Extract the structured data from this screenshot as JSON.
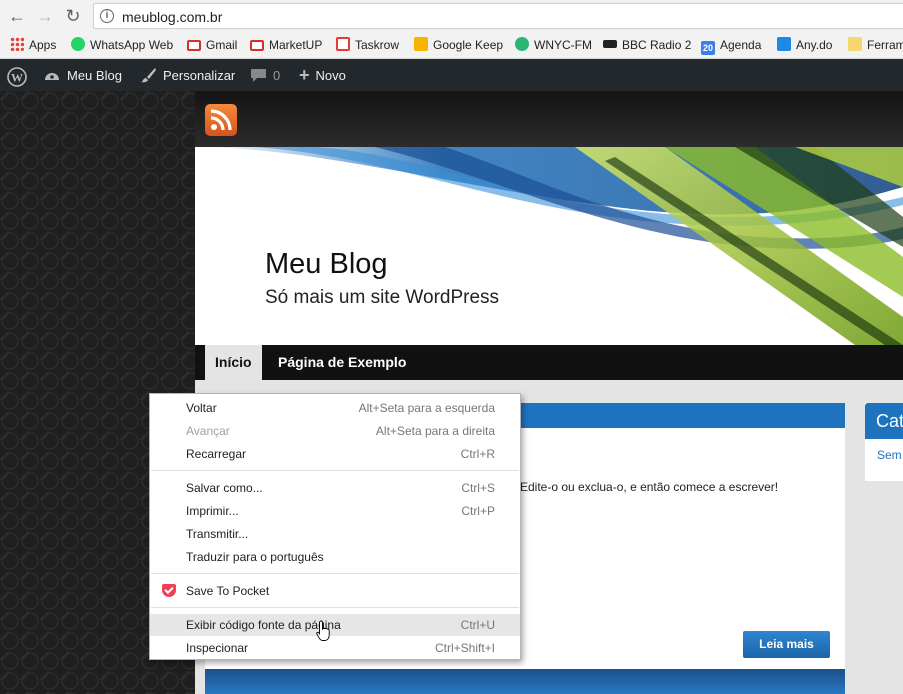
{
  "browser": {
    "url": "meublog.com.br",
    "bookmarks": [
      {
        "label": "Apps",
        "color": "#e94235"
      },
      {
        "label": "WhatsApp Web",
        "color": "#25d366"
      },
      {
        "label": "Gmail",
        "color": "#d93025"
      },
      {
        "label": "MarketUP",
        "color": "#d93025"
      },
      {
        "label": "Taskrow",
        "color": "#e53935"
      },
      {
        "label": "Google Keep",
        "color": "#f6b400"
      },
      {
        "label": "WNYC-FM",
        "color": "#2bb673"
      },
      {
        "label": "BBC Radio 2",
        "color": "#222222"
      },
      {
        "label": "Agenda",
        "color": "#3f7ee8",
        "badge": "20"
      },
      {
        "label": "Any.do",
        "color": "#1e88e5"
      },
      {
        "label": "Ferram",
        "color": "#f5d76e"
      }
    ]
  },
  "adminbar": {
    "site_name": "Meu Blog",
    "customize": "Personalizar",
    "comments_count": "0",
    "new_label": "Novo"
  },
  "site": {
    "title": "Meu Blog",
    "description": "Só mais um site WordPress",
    "menu": [
      "Início",
      "Página de Exemplo"
    ],
    "post_excerpt": "Edite-o ou exclua-o, e então comece a escrever!",
    "read_more": "Leia mais",
    "widget_title": "Cat",
    "widget_item": "Sem"
  },
  "context_menu": {
    "items": [
      {
        "label": "Voltar",
        "shortcut": "Alt+Seta para a esquerda",
        "disabled": false
      },
      {
        "label": "Avançar",
        "shortcut": "Alt+Seta para a direita",
        "disabled": true
      },
      {
        "label": "Recarregar",
        "shortcut": "Ctrl+R",
        "disabled": false
      },
      {
        "label": "Salvar como...",
        "shortcut": "Ctrl+S",
        "disabled": false
      },
      {
        "label": "Imprimir...",
        "shortcut": "Ctrl+P",
        "disabled": false
      },
      {
        "label": "Transmitir...",
        "shortcut": "",
        "disabled": false
      },
      {
        "label": "Traduzir para o português",
        "shortcut": "",
        "disabled": false
      },
      {
        "label": "Save To Pocket",
        "shortcut": "",
        "disabled": false
      },
      {
        "label": "Exibir código fonte da página",
        "shortcut": "Ctrl+U",
        "disabled": false
      },
      {
        "label": "Inspecionar",
        "shortcut": "Ctrl+Shift+I",
        "disabled": false
      }
    ]
  },
  "colors": {
    "accent": "#1e73be",
    "adminbar": "#23282d",
    "pocket": "#ef4056"
  }
}
